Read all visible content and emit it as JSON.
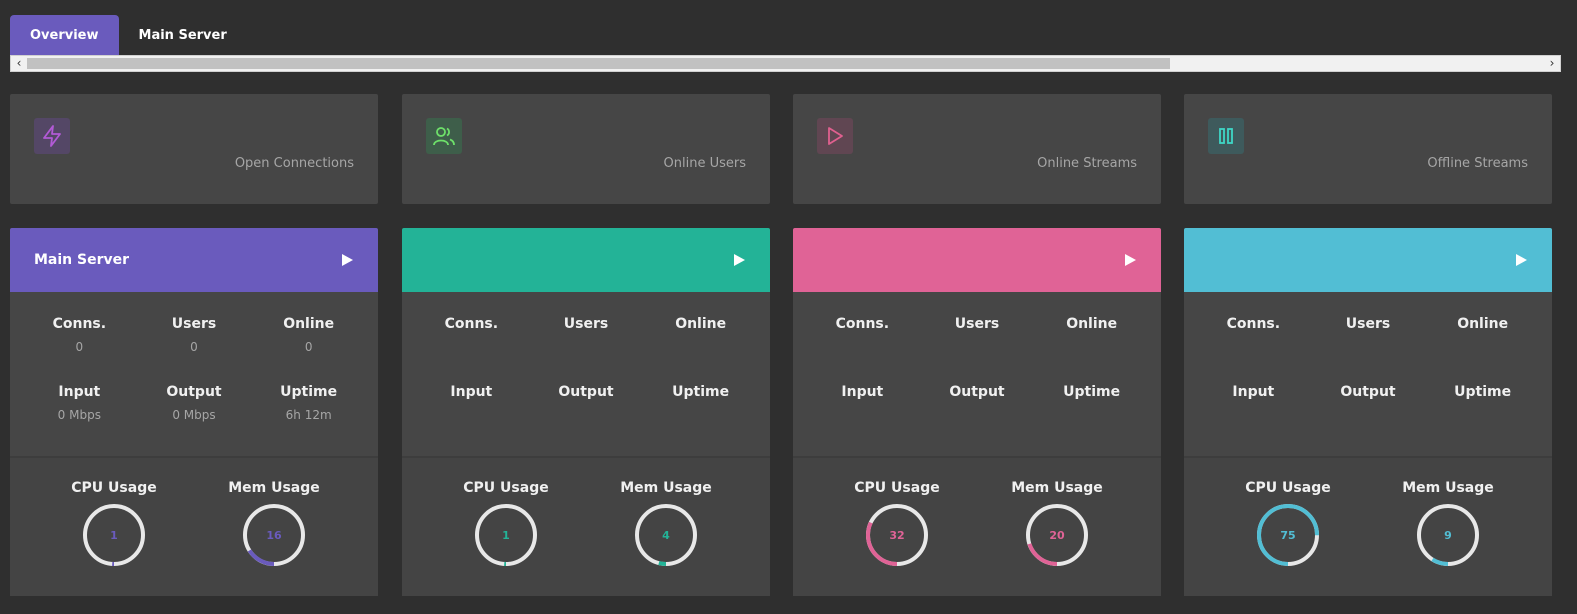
{
  "tabs": [
    {
      "label": "Overview",
      "active": true
    },
    {
      "label": "Main Server",
      "active": false
    }
  ],
  "stats": [
    {
      "label": "Open Connections",
      "icon": "lightning-icon",
      "color": "#b25ad6",
      "bg": "#544766"
    },
    {
      "label": "Online Users",
      "icon": "users-icon",
      "color": "#6ee06a",
      "bg": "#3e5e4a"
    },
    {
      "label": "Online Streams",
      "icon": "play-icon",
      "color": "#e0608f",
      "bg": "#604652"
    },
    {
      "label": "Offline Streams",
      "icon": "pause-icon",
      "color": "#3fd6c6",
      "bg": "#3e5a5c"
    }
  ],
  "servers": [
    {
      "title": "Main Server",
      "color": "#6a5bbd",
      "stats": [
        {
          "label": "Conns.",
          "value": "0"
        },
        {
          "label": "Users",
          "value": "0"
        },
        {
          "label": "Online",
          "value": "0"
        },
        {
          "label": "Input",
          "value": "0 Mbps"
        },
        {
          "label": "Output",
          "value": "0 Mbps"
        },
        {
          "label": "Uptime",
          "value": "6h 12m"
        }
      ],
      "cpu": {
        "label": "CPU Usage",
        "value": "1",
        "percent": 1
      },
      "mem": {
        "label": "Mem Usage",
        "value": "16",
        "percent": 16
      }
    },
    {
      "title": "",
      "color": "#23b397",
      "stats": [
        {
          "label": "Conns.",
          "value": ""
        },
        {
          "label": "Users",
          "value": ""
        },
        {
          "label": "Online",
          "value": ""
        },
        {
          "label": "Input",
          "value": ""
        },
        {
          "label": "Output",
          "value": ""
        },
        {
          "label": "Uptime",
          "value": ""
        }
      ],
      "cpu": {
        "label": "CPU Usage",
        "value": "1",
        "percent": 1
      },
      "mem": {
        "label": "Mem Usage",
        "value": "4",
        "percent": 4
      }
    },
    {
      "title": "",
      "color": "#e06396",
      "stats": [
        {
          "label": "Conns.",
          "value": ""
        },
        {
          "label": "Users",
          "value": ""
        },
        {
          "label": "Online",
          "value": ""
        },
        {
          "label": "Input",
          "value": ""
        },
        {
          "label": "Output",
          "value": ""
        },
        {
          "label": "Uptime",
          "value": ""
        }
      ],
      "cpu": {
        "label": "CPU Usage",
        "value": "32",
        "percent": 32
      },
      "mem": {
        "label": "Mem Usage",
        "value": "20",
        "percent": 20
      }
    },
    {
      "title": "",
      "color": "#52bed4",
      "stats": [
        {
          "label": "Conns.",
          "value": ""
        },
        {
          "label": "Users",
          "value": ""
        },
        {
          "label": "Online",
          "value": ""
        },
        {
          "label": "Input",
          "value": ""
        },
        {
          "label": "Output",
          "value": ""
        },
        {
          "label": "Uptime",
          "value": ""
        }
      ],
      "cpu": {
        "label": "CPU Usage",
        "value": "75",
        "percent": 75
      },
      "mem": {
        "label": "Mem Usage",
        "value": "9",
        "percent": 9
      }
    }
  ]
}
